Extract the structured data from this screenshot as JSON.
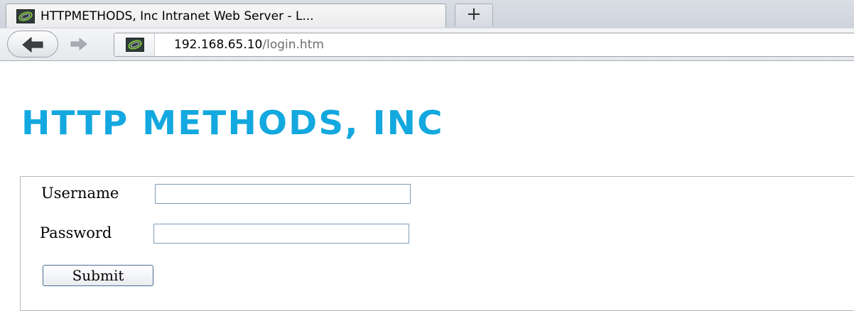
{
  "browser": {
    "tab_title": "HTTPMETHODS, Inc Intranet Web Server - L...",
    "new_tab_label": "+",
    "url_host": "192.168.65.10",
    "url_path": "/login.htm"
  },
  "page": {
    "heading": "HTTP METHODS, INC",
    "heading_color": "#13a8df"
  },
  "form": {
    "username_label": "Username",
    "username_value": "",
    "password_label": "Password",
    "password_value": "",
    "submit_label": "Submit"
  }
}
